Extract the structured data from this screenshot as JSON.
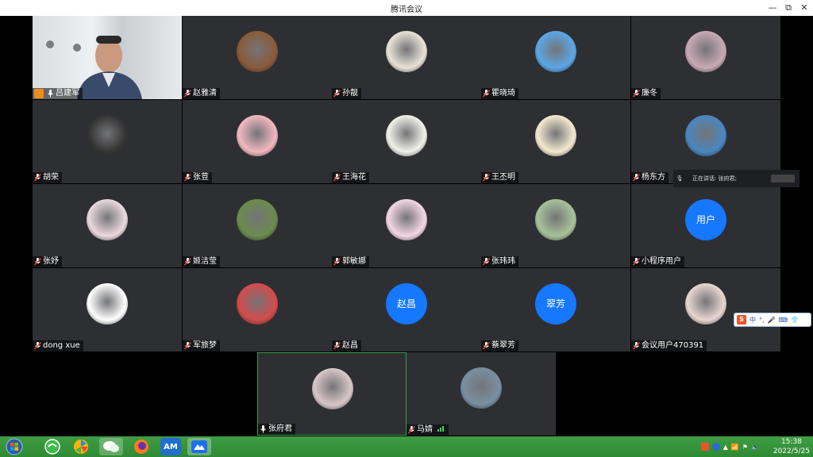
{
  "window": {
    "title": "腾讯会议",
    "minimize": "—",
    "restore": "⧉",
    "close": "✕"
  },
  "participants": [
    {
      "name": "吕建军",
      "avatar": "camera-video",
      "muted": false,
      "host": true
    },
    {
      "name": "赵雅清",
      "avatar": "photo-icon",
      "muted": true,
      "color": "#8a5a3a"
    },
    {
      "name": "孙靓",
      "avatar": "tiger-icon",
      "muted": true,
      "color": "#e9e2d6"
    },
    {
      "name": "瞿晓琦",
      "avatar": "sunflower-icon",
      "muted": true,
      "color": "#5aa7e6"
    },
    {
      "name": "廉冬",
      "avatar": "anime-girl-icon",
      "muted": true,
      "color": "#c9a9b4"
    },
    {
      "name": "胡荣",
      "avatar": "tunnel-icon",
      "muted": true,
      "color": "#333333"
    },
    {
      "name": "张荳",
      "avatar": "cat-cartoon-icon",
      "muted": true,
      "color": "#f2b8c0"
    },
    {
      "name": "王海花",
      "avatar": "flower-icon",
      "muted": true,
      "color": "#f1f1ea"
    },
    {
      "name": "王丕明",
      "avatar": "tiger-cartoon-icon",
      "muted": true,
      "color": "#f4e9cf"
    },
    {
      "name": "杨东方",
      "avatar": "snowflake-icon",
      "muted": true,
      "color": "#4a86c0"
    },
    {
      "name": "张妤",
      "avatar": "blossom-icon",
      "muted": true,
      "color": "#ead9dd"
    },
    {
      "name": "姬洁莹",
      "avatar": "child-photo-icon",
      "muted": true,
      "color": "#6b8b4e"
    },
    {
      "name": "郭敏娜",
      "avatar": "bunny-girl-icon",
      "muted": true,
      "color": "#f3d7e2"
    },
    {
      "name": "张玮玮",
      "avatar": "plant-icon",
      "muted": true,
      "color": "#a8c29a"
    },
    {
      "name": "小程序用户",
      "avatar": "text",
      "avatar_text": "用户",
      "muted": true
    },
    {
      "name": "dong xue",
      "avatar": "calligraphy-icon",
      "muted": true,
      "color": "#ffffff"
    },
    {
      "name": "军旅梦",
      "avatar": "portrait-icon",
      "muted": true,
      "color": "#d44b4b"
    },
    {
      "name": "赵昌",
      "avatar": "text",
      "avatar_text": "赵昌",
      "muted": true
    },
    {
      "name": "蔡翠芳",
      "avatar": "text",
      "avatar_text": "翠芳",
      "muted": true
    },
    {
      "name": "会议用户470391",
      "avatar": "woman-flower-icon",
      "muted": true,
      "color": "#e8d6d0"
    },
    {
      "name": "张府君",
      "avatar": "family-photo-icon",
      "muted": false,
      "active": true,
      "color": "#d9c7c9"
    },
    {
      "name": "马婧",
      "avatar": "group-photo-icon",
      "muted": true,
      "color": "#7a8fa3",
      "signal": true
    }
  ],
  "speaking": {
    "text": "正在讲话: 张府君;"
  },
  "ime": {
    "items": [
      "S",
      "中",
      "°,",
      "🎤",
      "⌨",
      "👕"
    ]
  },
  "taskbar": {
    "apps": [
      "start-button",
      "360-browser-icon",
      "pinwheel-icon",
      "wechat-icon",
      "firefox-icon",
      "am-icon",
      "tencent-meeting-icon"
    ],
    "am_label": "AM",
    "clock": {
      "time": "15:38",
      "date": "2022/5/25"
    }
  }
}
